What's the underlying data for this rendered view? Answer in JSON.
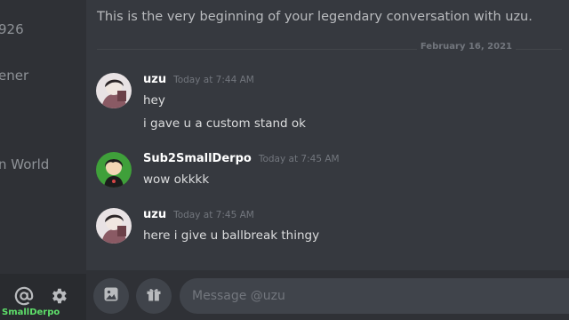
{
  "sidebar": {
    "items": [
      "926",
      "ener",
      "n World"
    ],
    "bottom_icons": [
      "at-icon",
      "gear-icon"
    ],
    "username": "SmallDerpo"
  },
  "channel": {
    "intro": "This is the very beginning of your legendary conversation with uzu.",
    "date_divider": "February 16, 2021"
  },
  "messages": [
    {
      "author": "uzu",
      "timestamp": "Today at 7:44 AM",
      "lines": [
        "hey",
        "i gave u a custom stand ok"
      ]
    },
    {
      "author": "Sub2SmallDerpo",
      "timestamp": "Today at 7:45 AM",
      "lines": [
        "wow okkkk"
      ]
    },
    {
      "author": "uzu",
      "timestamp": "Today at 7:45 AM",
      "lines": [
        "here i give u ballbreak thingy"
      ]
    }
  ],
  "composer": {
    "placeholder": "Message @uzu",
    "buttons": [
      "image-icon",
      "gift-icon"
    ]
  },
  "colors": {
    "background": "#36393f",
    "sidebar": "#2f3136",
    "input": "#40444b",
    "username_overlay": "#5ee06a"
  }
}
